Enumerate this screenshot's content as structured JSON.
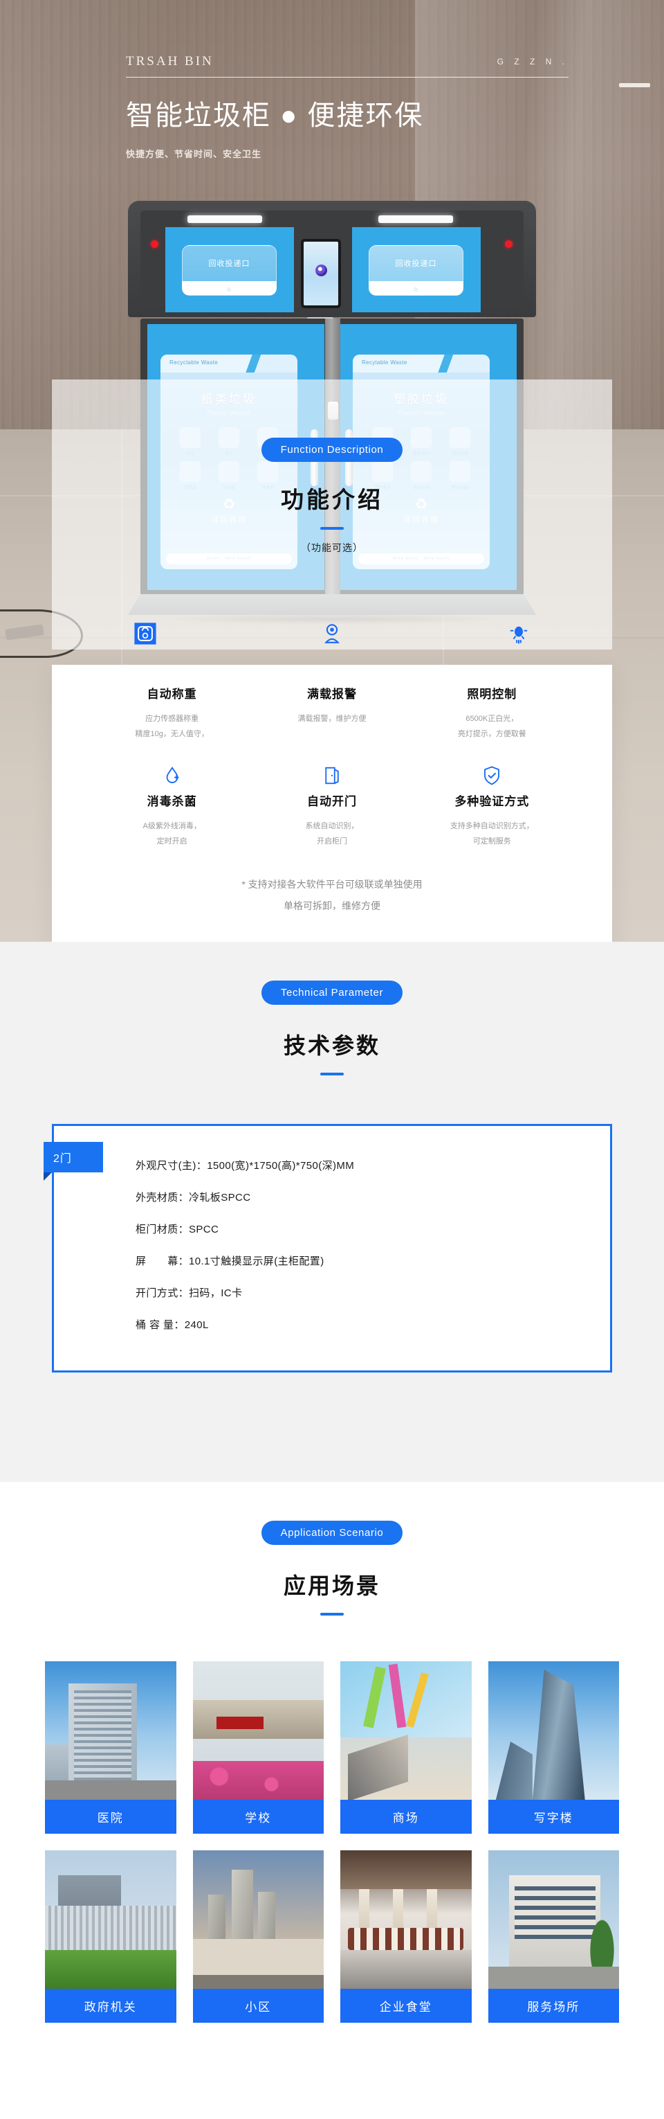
{
  "hero": {
    "brand_left": "TRSAH  BIN",
    "brand_right": "G Z Z N .",
    "title": "智能垃圾柜  ●  便捷环保",
    "subtitle": "快捷方便、节省时间、安全卫生",
    "kiosk": {
      "slot_label_left": "回收投递口",
      "slot_label_right": "回收投递口",
      "recycle_mark_left": "♲",
      "recycle_mark_right": "♲",
      "nfc_label": "((●))",
      "card_left": {
        "tab": "Recyclable Waste",
        "title": "纸类垃圾",
        "subtitle": "Paper Waste",
        "items": [
          "书本",
          "报纸",
          "复印纸",
          "手提袋",
          "包装盒",
          "快递盒"
        ],
        "recycle_glyph": "♻",
        "recycle_label": "可回收物",
        "footer": "Green , More health"
      },
      "card_right": {
        "tab": "Recylable Waste",
        "title": "塑胶垃圾",
        "subtitle": "Plastic Waste",
        "items": [
          "塑料袋",
          "塑胶盒子",
          "塑胶垃圾",
          "饮料瓶子",
          "塑胶玩具",
          "塑胶包装"
        ],
        "recycle_glyph": "♻",
        "recycle_label": "可回收物",
        "footer": "More Green , More health"
      }
    }
  },
  "function_section": {
    "pill": "Function Description",
    "title_cn": "功能介绍",
    "note": "（功能可选）",
    "features": [
      {
        "icon": "weight-scale-icon",
        "glyph": "⚖",
        "title": "自动称重",
        "desc_line1": "应力传感器称重",
        "desc_line2": "精度10g，无人值守，",
        "highlight": true
      },
      {
        "icon": "camera-alarm-icon",
        "glyph": "◎",
        "title": "满载报警",
        "desc_line1": "满载报警，维护方便",
        "desc_line2": "",
        "highlight": false
      },
      {
        "icon": "light-bulb-icon",
        "glyph": "☀",
        "title": "照明控制",
        "desc_line1": "6500K正白光，",
        "desc_line2": "亮灯提示，方便取餐",
        "highlight": false
      },
      {
        "icon": "disinfect-drop-icon",
        "glyph": "💧",
        "title": "消毒杀菌",
        "desc_line1": "A级紫外线消毒，",
        "desc_line2": "定时开启",
        "highlight": false
      },
      {
        "icon": "auto-door-icon",
        "glyph": "🚪",
        "title": "自动开门",
        "desc_line1": "系统自动识别，",
        "desc_line2": "开启柜门",
        "highlight": false
      },
      {
        "icon": "shield-check-icon",
        "glyph": "🛡",
        "title": "多种验证方式",
        "desc_line1": "支持多种自动识别方式，",
        "desc_line2": "可定制服务",
        "highlight": false
      }
    ],
    "footnote_line1": "* 支持对接各大软件平台可级联或单独使用",
    "footnote_line2": "单格可拆卸，维修方便"
  },
  "tech_section": {
    "pill": "Technical  Parameter",
    "title_cn": "技术参数",
    "tag": "2门",
    "rows": [
      "外观尺寸(主)：1500(宽)*1750(高)*750(深)MM",
      "外壳材质：冷轧板SPCC",
      "柜门材质：SPCC",
      "屏　　幕：10.1寸触摸显示屏(主柜配置)",
      "开门方式：扫码，IC卡",
      "桶 容 量：240L"
    ]
  },
  "scenario_section": {
    "pill": "Application  Scenario",
    "title_cn": "应用场景",
    "items": [
      {
        "label": "医院",
        "photo": "hospital-photo"
      },
      {
        "label": "学校",
        "photo": "school-photo"
      },
      {
        "label": "商场",
        "photo": "mall-photo"
      },
      {
        "label": "写字楼",
        "photo": "office-building-photo"
      },
      {
        "label": "政府机关",
        "photo": "government-photo"
      },
      {
        "label": "小区",
        "photo": "community-photo"
      },
      {
        "label": "企业食堂",
        "photo": "canteen-photo"
      },
      {
        "label": "服务场所",
        "photo": "service-venue-photo"
      }
    ]
  },
  "colors": {
    "accent": "#1a73f0",
    "accent_dark": "#1a6bf5",
    "kiosk_blue": "#33a9e8",
    "red_led": "#ed1c24"
  }
}
